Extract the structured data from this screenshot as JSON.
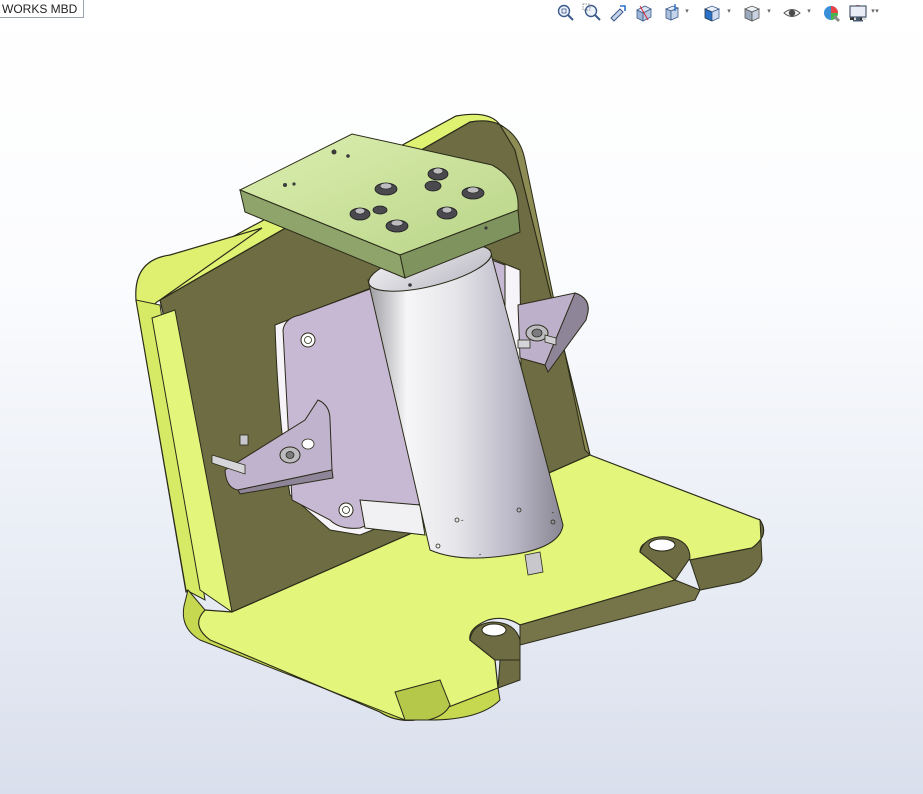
{
  "tab": {
    "label": "WORKS MBD"
  },
  "toolbar": {
    "buttons": [
      {
        "name": "zoom-to-fit-icon"
      },
      {
        "name": "zoom-to-area-icon"
      },
      {
        "name": "previous-view-icon"
      },
      {
        "name": "section-view-icon"
      },
      {
        "name": "dynamic-annotation-views-icon"
      },
      {
        "name": "view-orientation-icon"
      },
      {
        "name": "display-style-icon"
      },
      {
        "name": "hide-show-items-icon"
      },
      {
        "name": "edit-appearance-icon"
      },
      {
        "name": "apply-scene-icon"
      },
      {
        "name": "view-settings-icon"
      }
    ]
  },
  "colors": {
    "plate_light": "#e3f57a",
    "plate_mid": "#c9dc55",
    "plate_dark": "#6b6a3f",
    "plate_edge": "#2b2b1a",
    "top_plate": "#cfe6a0",
    "motor_light": "#f4f4f6",
    "motor_mid": "#c9c9cf",
    "bracket": "#b9a9c8",
    "bracket_light": "#d6cce0"
  }
}
